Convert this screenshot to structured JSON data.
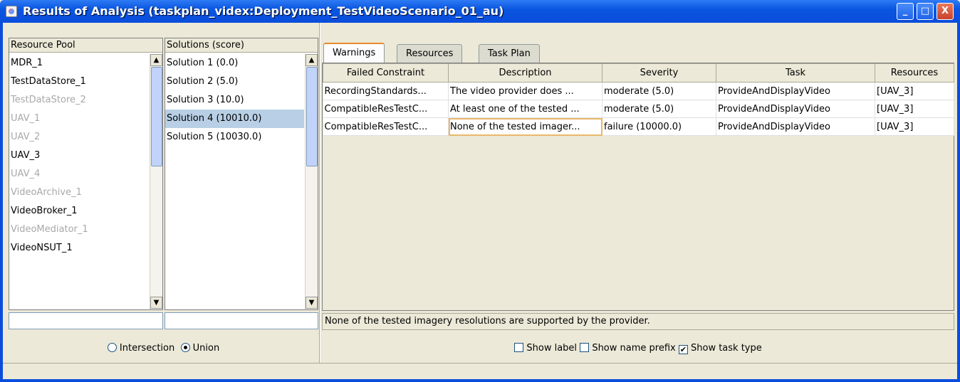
{
  "window": {
    "title": "Results of Analysis (taskplan_videx:Deployment_TestVideoScenario_01_au)",
    "minimize": "_",
    "maximize": "□",
    "close": "X"
  },
  "resource_pool": {
    "header": "Resource Pool",
    "items": [
      {
        "label": "MDR_1",
        "enabled": true
      },
      {
        "label": "TestDataStore_1",
        "enabled": true
      },
      {
        "label": "TestDataStore_2",
        "enabled": false
      },
      {
        "label": "UAV_1",
        "enabled": false
      },
      {
        "label": "UAV_2",
        "enabled": false
      },
      {
        "label": "UAV_3",
        "enabled": true
      },
      {
        "label": "UAV_4",
        "enabled": false
      },
      {
        "label": "VideoArchive_1",
        "enabled": false
      },
      {
        "label": "VideoBroker_1",
        "enabled": true
      },
      {
        "label": "VideoMediator_1",
        "enabled": false
      },
      {
        "label": "VideoNSUT_1",
        "enabled": true
      }
    ],
    "filter_value": ""
  },
  "solutions": {
    "header": "Solutions (score)",
    "items": [
      {
        "label": "Solution 1 (0.0)",
        "selected": false
      },
      {
        "label": "Solution 2 (5.0)",
        "selected": false
      },
      {
        "label": "Solution 3 (10.0)",
        "selected": false
      },
      {
        "label": "Solution 4 (10010.0)",
        "selected": true
      },
      {
        "label": "Solution 5 (10030.0)",
        "selected": false
      }
    ],
    "filter_value": ""
  },
  "mode": {
    "intersection_label": "Intersection",
    "union_label": "Union",
    "selected": "union"
  },
  "tabs": [
    {
      "label": "Warnings",
      "active": true
    },
    {
      "label": "Resources",
      "active": false
    },
    {
      "label": "Task Plan",
      "active": false
    }
  ],
  "warnings_table": {
    "columns": [
      "Failed Constraint",
      "Description",
      "Severity",
      "Task",
      "Resources"
    ],
    "rows": [
      [
        "RecordingStandards...",
        "The video provider does ...",
        "moderate (5.0)",
        "ProvideAndDisplayVideo",
        "[UAV_3]"
      ],
      [
        "CompatibleResTestC...",
        "At least one of the tested ...",
        "moderate (5.0)",
        "ProvideAndDisplayVideo",
        "[UAV_3]"
      ],
      [
        "CompatibleResTestC...",
        "None of the tested imager...",
        "failure (10000.0)",
        "ProvideAndDisplayVideo",
        "[UAV_3]"
      ]
    ],
    "focused_cell": "2.1"
  },
  "detail_text": "None of the tested imagery resolutions are supported by the provider.",
  "options": {
    "show_label": {
      "label": "Show label",
      "checked": false
    },
    "show_name_prefix": {
      "label": "Show name prefix",
      "checked": false
    },
    "show_task_type": {
      "label": "Show task type",
      "checked": true
    }
  }
}
